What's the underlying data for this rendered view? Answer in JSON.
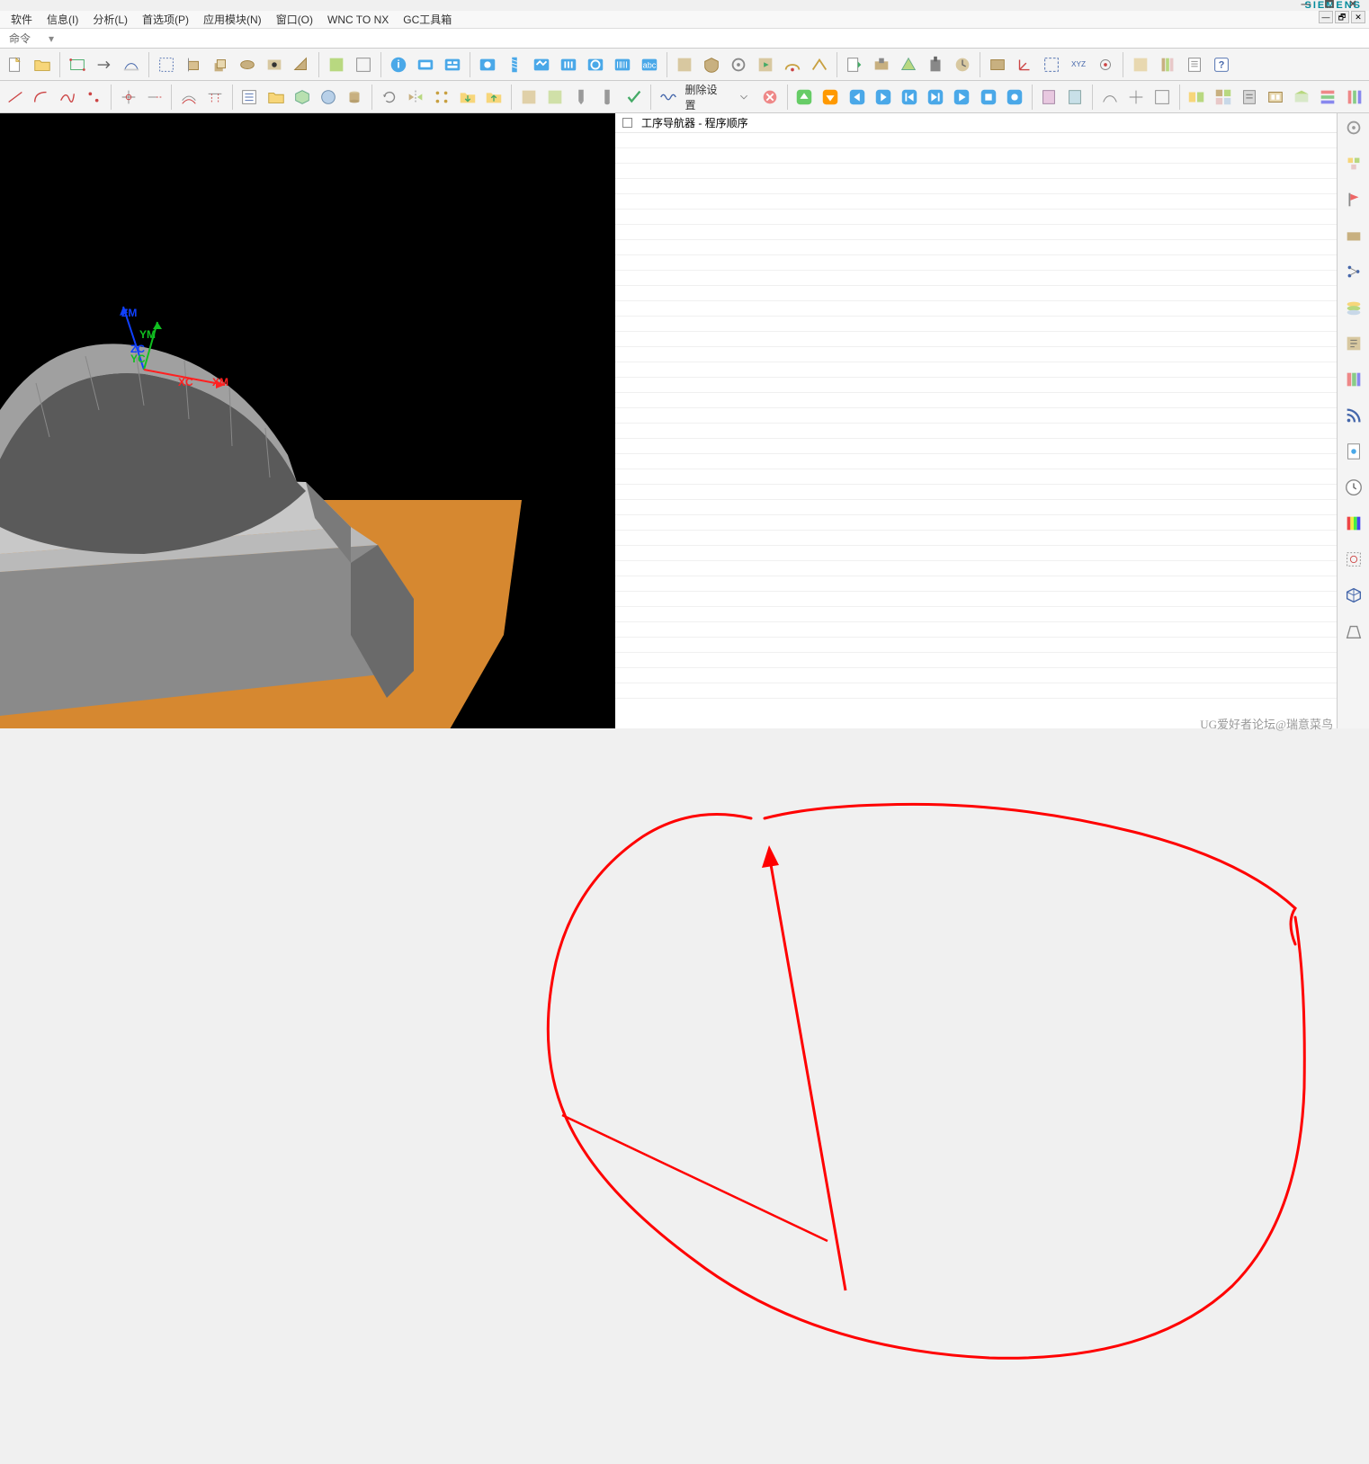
{
  "brand": "SIEMENS",
  "menu": {
    "software": "软件",
    "info": "信息(I)",
    "analysis": "分析(L)",
    "preferences": "首选项(P)",
    "app_module": "应用模块(N)",
    "window": "窗口(O)",
    "wnc_to_nx": "WNC TO NX",
    "gc_toolbox": "GC工具箱"
  },
  "command_label": "命令",
  "toolbar2_labels": {
    "delete_settings": "删除设置"
  },
  "navigator": {
    "title": "工序导航器 - 程序顺序"
  },
  "axes": {
    "zm": "ZM",
    "ym": "YM",
    "zc": "ZC",
    "yc": "YC",
    "xc": "XC",
    "xm": "XM"
  },
  "watermark": "UG爱好者论坛@瑞意菜鸟"
}
